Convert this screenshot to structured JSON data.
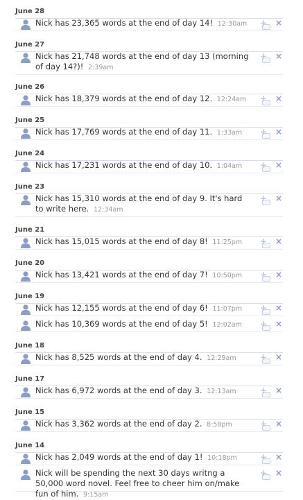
{
  "icons": {
    "user": "user-silhouette-icon",
    "like": "add-comment-plus-icon",
    "remove": "remove-x-icon"
  },
  "colors": {
    "link_blue": "#3b5998",
    "divider": "#d8dfea",
    "icon_blue": "#8b9dc3"
  },
  "remove_glyph": "×",
  "days": [
    {
      "date": "June 28",
      "entries": [
        {
          "text": "Nick has 23,365 words at the end of day 14!",
          "time": "12:30am"
        }
      ]
    },
    {
      "date": "June 27",
      "entries": [
        {
          "text": "Nick has 21,748 words at the end of day 13 (morning of day 14?)!",
          "time": "2:39am"
        }
      ]
    },
    {
      "date": "June 26",
      "entries": [
        {
          "text": "Nick has 18,379 words at the end of day 12.",
          "time": "12:24am"
        }
      ]
    },
    {
      "date": "June 25",
      "entries": [
        {
          "text": "Nick has 17,769 words at the end of day 11.",
          "time": "1:33am"
        }
      ]
    },
    {
      "date": "June 24",
      "entries": [
        {
          "text": "Nick has 17,231 words at the end of day 10.",
          "time": "1:04am"
        }
      ]
    },
    {
      "date": "June 23",
      "entries": [
        {
          "text": "Nick has 15,310 words at the end of day 9. It's hard to write here.",
          "time": "12:34am"
        }
      ]
    },
    {
      "date": "June 21",
      "entries": [
        {
          "text": "Nick has 15,015 words at the end of day 8!",
          "time": "11:25pm"
        }
      ]
    },
    {
      "date": "June 20",
      "entries": [
        {
          "text": "Nick has 13,421 words at the end of day 7!",
          "time": "10:50pm"
        }
      ]
    },
    {
      "date": "June 19",
      "entries": [
        {
          "text": "Nick has 12,155 words at the end of day 6!",
          "time": "11:07pm"
        },
        {
          "text": "Nick has 10,369 words at the end of day 5!",
          "time": "12:02am"
        }
      ]
    },
    {
      "date": "June 18",
      "entries": [
        {
          "text": "Nick has 8,525 words at the end of day 4.",
          "time": "12:29am"
        }
      ]
    },
    {
      "date": "June 17",
      "entries": [
        {
          "text": "Nick has 6,972 words at the end of day 3.",
          "time": "12:13am"
        }
      ]
    },
    {
      "date": "June 15",
      "entries": [
        {
          "text": "Nick has 3,362 words at the end of day 2.",
          "time": "8:58pm"
        }
      ]
    },
    {
      "date": "June 14",
      "entries": [
        {
          "text": "Nick has 2,049 words at the end of day 1!",
          "time": "10:18pm"
        },
        {
          "text": "Nick will be spending the next 30 days writng a 50,000 word novel. Feel free to cheer him on/make fun of him.",
          "time": "9:15am"
        }
      ]
    }
  ]
}
